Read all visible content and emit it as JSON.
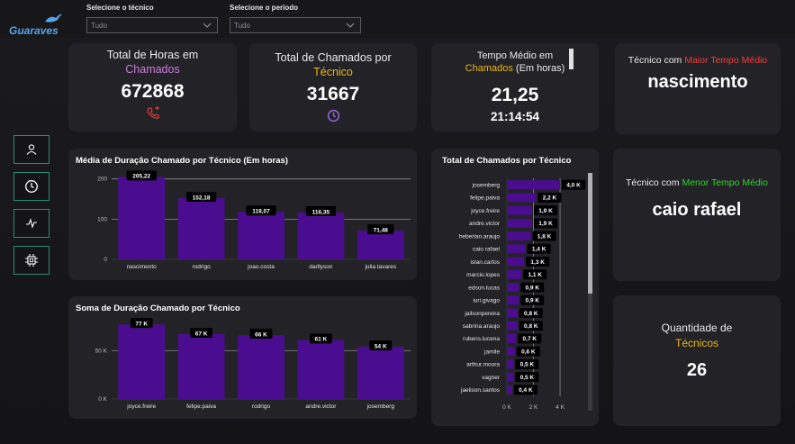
{
  "brand": {
    "logo_text": "Guaraves"
  },
  "filters": {
    "tecnico": {
      "label": "Selecione o técnico",
      "value": "Tudo"
    },
    "periodo": {
      "label": "Selecione o período",
      "value": "Tudo"
    }
  },
  "nav": [
    {
      "icon": "user-icon"
    },
    {
      "icon": "clock-icon"
    },
    {
      "icon": "pulse-icon"
    },
    {
      "icon": "chip-icon"
    }
  ],
  "kpis": {
    "total_horas": {
      "title_a": "Total de Horas em",
      "title_b": "Chamados",
      "value": "672868",
      "icon": "phone-forward-icon"
    },
    "total_chamados": {
      "title_a": "Total de Chamados por",
      "title_b": "Técnico",
      "value": "31667",
      "icon": "clock-icon"
    },
    "tempo_medio": {
      "title_a": "Tempo Médio em",
      "title_b": "Chamados",
      "title_c": "(Em horas)",
      "value": "21,25",
      "value2": "21:14:54"
    },
    "maior_tempo": {
      "title_a": "Técnico com",
      "title_b": "Maior Tempo Médio",
      "value": "nascimento"
    },
    "menor_tempo": {
      "title_a": "Técnico com",
      "title_b": "Menor Tempo Médio",
      "value": "caio rafael"
    },
    "qtd_tecnicos": {
      "title_a": "Quantidade de",
      "title_b": "Técnicos",
      "value": "26"
    }
  },
  "colors": {
    "bar": "#4b0d8f",
    "accent_purple": "#c77dd8",
    "accent_gold": "#e8b71a",
    "accent_red": "#f23b3b",
    "accent_green": "#30d130",
    "nav_border": "#2f8a72"
  },
  "chart_data": [
    {
      "type": "bar",
      "title": "Média de Duração Chamado por Técnico (Em horas)",
      "categories": [
        "nascimento",
        "rodrigo",
        "joao.costa",
        "darllyson",
        "julia.tavares"
      ],
      "values": [
        205.22,
        152.18,
        118.07,
        116.35,
        71.48
      ],
      "labels": [
        "205,22",
        "152,18",
        "118,07",
        "116,35",
        "71,48"
      ],
      "yticks": [
        0,
        100,
        200
      ],
      "ytick_labels": [
        "0",
        "100",
        "200"
      ],
      "ylim": [
        0,
        215
      ],
      "grid": true
    },
    {
      "type": "bar",
      "title": "Soma de Duração Chamado por Técnico",
      "categories": [
        "joyce.freire",
        "felipe.paiva",
        "rodrigo",
        "andre.victor",
        "josemberg"
      ],
      "values": [
        77,
        67,
        66,
        61,
        54
      ],
      "labels": [
        "77 K",
        "67 K",
        "66 K",
        "61 K",
        "54 K"
      ],
      "yticks": [
        0,
        50
      ],
      "ytick_labels": [
        "0 K",
        "50 K"
      ],
      "ylim": [
        0,
        80
      ],
      "grid": true
    },
    {
      "type": "bar",
      "orientation": "horizontal",
      "title": "Total de Chamados por Técnico",
      "categories": [
        "josemberg",
        "felipe.paiva",
        "joyce.freire",
        "andre.victor",
        "heberlan.araujo",
        "caio rafael",
        "islan.carlos",
        "marcio.lopes",
        "edson.lucas",
        "iuri.givago",
        "jailsonpereira",
        "sabrina.araujo",
        "rubens.lucena",
        "jamile",
        "arthur.moura",
        "vagner",
        "jaelison.santos"
      ],
      "values": [
        4.0,
        2.2,
        1.9,
        1.9,
        1.8,
        1.4,
        1.3,
        1.1,
        0.9,
        0.9,
        0.8,
        0.8,
        0.7,
        0.6,
        0.5,
        0.5,
        0.4
      ],
      "labels": [
        "4,0 K",
        "2,2 K",
        "1,9 K",
        "1,9 K",
        "1,8 K",
        "1,4 K",
        "1,3 K",
        "1,1 K",
        "0,9 K",
        "0,9 K",
        "0,8 K",
        "0,8 K",
        "0,7 K",
        "0,6 K",
        "0,5 K",
        "0,5 K",
        "0,4 K"
      ],
      "xticks": [
        0,
        2,
        4
      ],
      "xtick_labels": [
        "0 K",
        "2 K",
        "4 K"
      ],
      "xlim": [
        0,
        4.2
      ],
      "grid": true
    }
  ]
}
